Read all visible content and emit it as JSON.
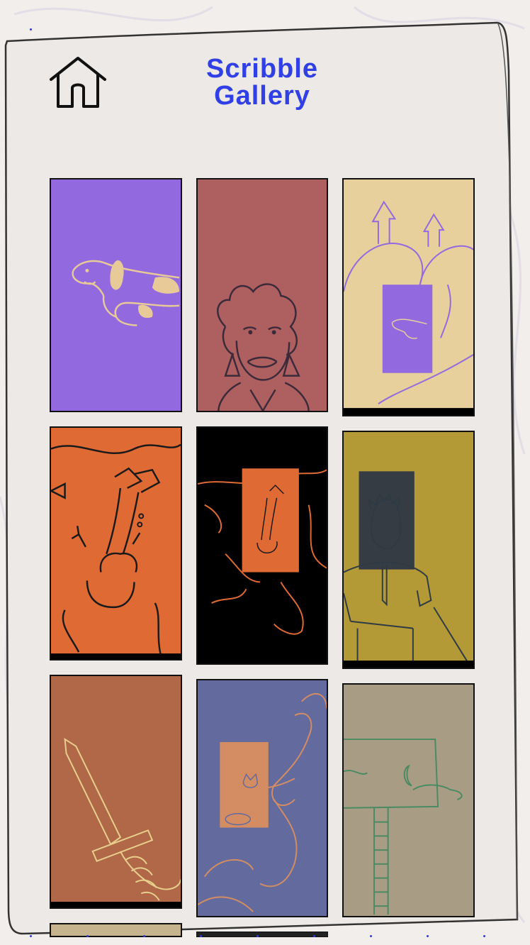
{
  "header": {
    "title_line1": "Scribble",
    "title_line2": "Gallery",
    "home_icon": "home-icon"
  },
  "colors": {
    "title": "#3140e6",
    "page_bg": "#f1eeec",
    "frame_stroke": "#333333"
  },
  "gallery": {
    "items": [
      {
        "name": "dachshund-on-purple",
        "bg": "#9369e0",
        "line": "#e8c998"
      },
      {
        "name": "woman-portrait",
        "bg": "#ae5f5f",
        "line": "#3a2a3a"
      },
      {
        "name": "castle-hills-with-dog",
        "bg": "#e8d09c",
        "line": "#9369e0"
      },
      {
        "name": "snorkel-diver",
        "bg": "#e06a34",
        "line": "#1a1a1a"
      },
      {
        "name": "diver-inverted",
        "bg": "#000000",
        "line": "#e06a34"
      },
      {
        "name": "man-in-yellow-shirt",
        "bg": "#b39a36",
        "line": "#2e3a44"
      },
      {
        "name": "sword-in-hand",
        "bg": "#b06848",
        "line": "#e8d08c"
      },
      {
        "name": "cat-and-tentacles",
        "bg": "#636a9e",
        "line": "#d48d62"
      },
      {
        "name": "ladder-to-moon",
        "bg": "#a89d84",
        "line": "#4a8a62"
      },
      {
        "name": "partial-tile",
        "bg": "#c6b48e",
        "line": "#333333"
      },
      {
        "name": "partial-tile",
        "bg": "#222222",
        "line": "#333333"
      }
    ]
  }
}
